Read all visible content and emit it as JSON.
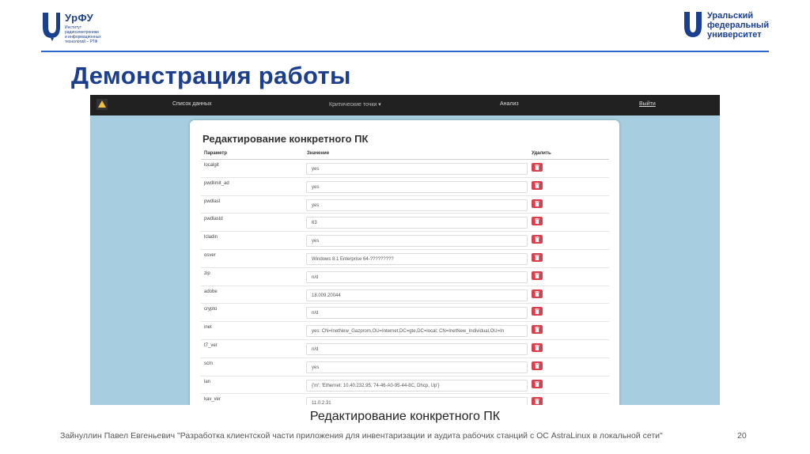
{
  "header": {
    "left_logo": {
      "title": "УрФУ",
      "subtitle": "Институт\nрадиоэлектроники\nи информационных\nтехнологий – РТФ"
    },
    "right_logo": {
      "line1": "Уральский",
      "line2": "федеральный",
      "line3": "университет"
    },
    "accent_color": "#1c3e8e"
  },
  "slide_title": "Демонстрация работы",
  "app": {
    "navbar": {
      "items": [
        "Список данных",
        "Критические точки ▾",
        "Анализ",
        "Выйти"
      ]
    },
    "card_title": "Редактирование конкретного ПК",
    "columns": [
      "Параметр",
      "Значение",
      "Удалить"
    ],
    "rows": [
      {
        "param": "localgit",
        "value": "yes"
      },
      {
        "param": "pwdlimit_ad",
        "value": "yes"
      },
      {
        "param": "pwdlast",
        "value": "yes"
      },
      {
        "param": "pwdlastd",
        "value": "63"
      },
      {
        "param": "lcladin",
        "value": "yes"
      },
      {
        "param": "osver",
        "value": "Windows 8.1 Enterprise 64-?????????"
      },
      {
        "param": "zip",
        "value": "n/d"
      },
      {
        "param": "adobe",
        "value": "18.009.20044"
      },
      {
        "param": "crypto",
        "value": "n/d"
      },
      {
        "param": "inet",
        "value": "yes: CN=InetNew_Gazprom,OU=Internet,DC=gte,DC=local; CN=InetNew_Individual,OU=In"
      },
      {
        "param": "t7_ver",
        "value": "n/d"
      },
      {
        "param": "scm",
        "value": "yes"
      },
      {
        "param": "lan",
        "value": "{'m': 'Ethernet: 10.40.232.95, 74-46-A0-95-44-8C, Dhcp, Up'}"
      },
      {
        "param": "kav_ver",
        "value": "11.0.2.31"
      }
    ],
    "delete_color": "#d9404d"
  },
  "caption": "Редактирование конкретного ПК",
  "footer": "Зайнуллин Павел Евгеньевич \"Разработка клиентской части приложения для инвентаризации и аудита рабочих станций с ОС AstraLinux в локальной сети\"",
  "page_number": "20"
}
